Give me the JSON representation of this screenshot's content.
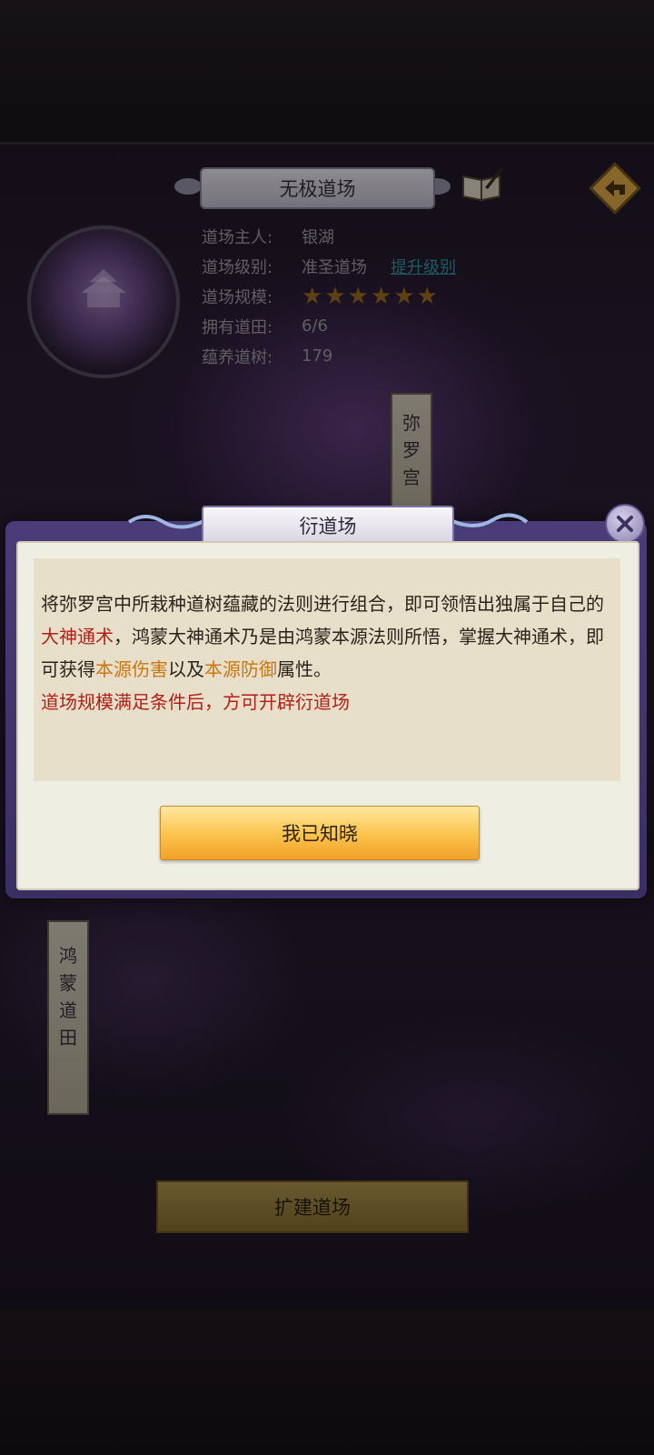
{
  "header": {
    "title": "无极道场",
    "book_icon": "book-quill-icon",
    "back_icon": "back-arrow-icon"
  },
  "info": {
    "owner_label": "道场主人:",
    "owner_value": "银湖",
    "level_label": "道场级别:",
    "level_value": "准圣道场",
    "upgrade_link": "提升级别",
    "scale_label": "道场规模:",
    "scale_stars": 6,
    "fields_label": "拥有道田:",
    "fields_value": "6/6",
    "trees_label": "蕴养道树:",
    "trees_value": "179"
  },
  "map": {
    "palace_label": [
      "弥",
      "罗",
      "宫"
    ],
    "field_label": [
      "鸿",
      "蒙",
      "道",
      "田"
    ],
    "expand_button": "扩建道场"
  },
  "dialog": {
    "title": "衍道场",
    "text_part1": "将弥罗宫中所栽种道树蕴藏的法则进行组合，即可领悟出独属于自己的",
    "highlight1": "大神通术",
    "text_part2": "，鸿蒙大神通术乃是由鸿蒙本源法则所悟，掌握大神通术，即可获得",
    "highlight2": "本源伤害",
    "text_part3": "以及",
    "highlight3": "本源防御",
    "text_part4": "属性。",
    "warning": "道场规模满足条件后，方可开辟衍道场",
    "confirm_button": "我已知晓",
    "close_icon": "close-icon"
  },
  "colors": {
    "highlight_red": "#b41e16",
    "highlight_gold": "#c7770f",
    "link": "#2f9fb2",
    "dialog_frame": "#3a2f62",
    "button_gold": "#fbc24a"
  }
}
